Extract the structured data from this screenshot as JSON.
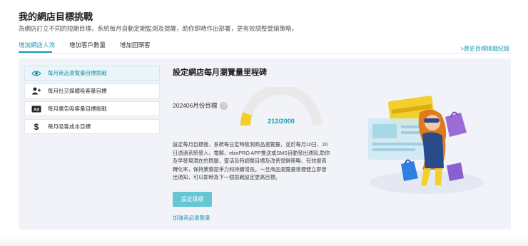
{
  "header": {
    "title": "我的網店目標挑戰",
    "subtitle": "為網店訂立不同的短期目標，系統每月自動定期監測及提醒，助你即時作出部署，更有效調整營銷策略。"
  },
  "tabs": [
    {
      "label": "增加網店人流",
      "active": true
    },
    {
      "label": "增加客戶數量",
      "active": false
    },
    {
      "label": "增加回頭客",
      "active": false
    }
  ],
  "history_link": ">歷史目標挑戰紀錄",
  "sidebar": {
    "items": [
      {
        "label": "每月商品瀏覽量目標挑戰",
        "icon": "eye-icon",
        "active": true
      },
      {
        "label": "每月社交媒體吸客量目標",
        "icon": "add-user-icon",
        "active": false
      },
      {
        "label": "每月廣告吸客量目標挑戰",
        "icon": "ad-icon",
        "active": false
      },
      {
        "label": "每月吸客成本目標",
        "icon": "dollar-icon",
        "active": false
      }
    ]
  },
  "main": {
    "title": "設定網店每月瀏覽量里程碑",
    "month_goal_label": "202406月份目標",
    "gauge": {
      "current": 212,
      "target": 2000,
      "display": "212/2000"
    },
    "description": "設定每月目標後，系統每日定時檢測商品瀏覽量，並於每月10日、20日透過系統登入、電郵、ebixPRO APP推送或SMS自動發出通知,助你及早發現潛在的問題，靈活及時調整目標及改善營銷策略、有效提高轉化率，保持業務競爭力和持續增長。一旦商品瀏覽量達標便立即發出通知，可以即時為下一個挑戰設定更高目標。",
    "set_goal_button": "設定目標",
    "bottom_link": "加強商品瀏覽量"
  },
  "colors": {
    "accent": "#1a9bb8",
    "button": "#66c6d4",
    "gauge_fill": "#f2cf2b",
    "gauge_track": "#e9e9e9",
    "panel_bg": "#f1f3f8"
  }
}
